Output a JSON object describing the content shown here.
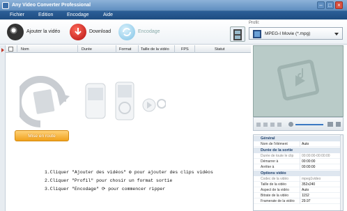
{
  "window": {
    "title": "Any Video Converter Professional"
  },
  "menu": {
    "items": [
      "Fichier",
      "Edition",
      "Encodage",
      "Aide"
    ]
  },
  "toolbar": {
    "add_label": "Ajouter la vidéo",
    "download_label": "Download",
    "encode_label": "Encodage"
  },
  "profile": {
    "label": "Profil:",
    "selected": "MPEG-I Movie (*.mpg)"
  },
  "columns": [
    "Nom",
    "Durée",
    "Format",
    "Taille de la vidéo",
    "FPS",
    "Statut"
  ],
  "convert_button": "Mise en route",
  "steps": [
    "1.Cliquer \"Ajouter des vidéos\" ⚙ pour ajouter des clips vidéos",
    "2.Cliquer \"Profil\" pour chosir un format sortie",
    "3.Cliquer \"Encodage\" ⟳ pour commencer ripper"
  ],
  "properties": {
    "general": "Général",
    "name_key": "Nom de l'élément",
    "name_val": "Auto",
    "duration_section": "Durée de la sortie",
    "clip_dur_key": "Durée de toute le clip",
    "clip_dur_val": "00:00:00-00:00:00",
    "start_key": "Démarrer à",
    "start_val": "00:00:00",
    "stop_key": "Arrêter à",
    "stop_val": "00:00:00",
    "video_section": "Options vidéo",
    "codec_key": "Codec de la vidéo",
    "codec_val": "mpeg1video",
    "size_key": "Taille de la vidéo",
    "size_val": "352x240",
    "aspect_key": "Aspect de la vidéo",
    "aspect_val": "Auto",
    "bitrate_key": "Bitrate de la vidéo",
    "bitrate_val": "1152",
    "framerate_key": "Framerate de la vidéo",
    "framerate_val": "29.97"
  }
}
